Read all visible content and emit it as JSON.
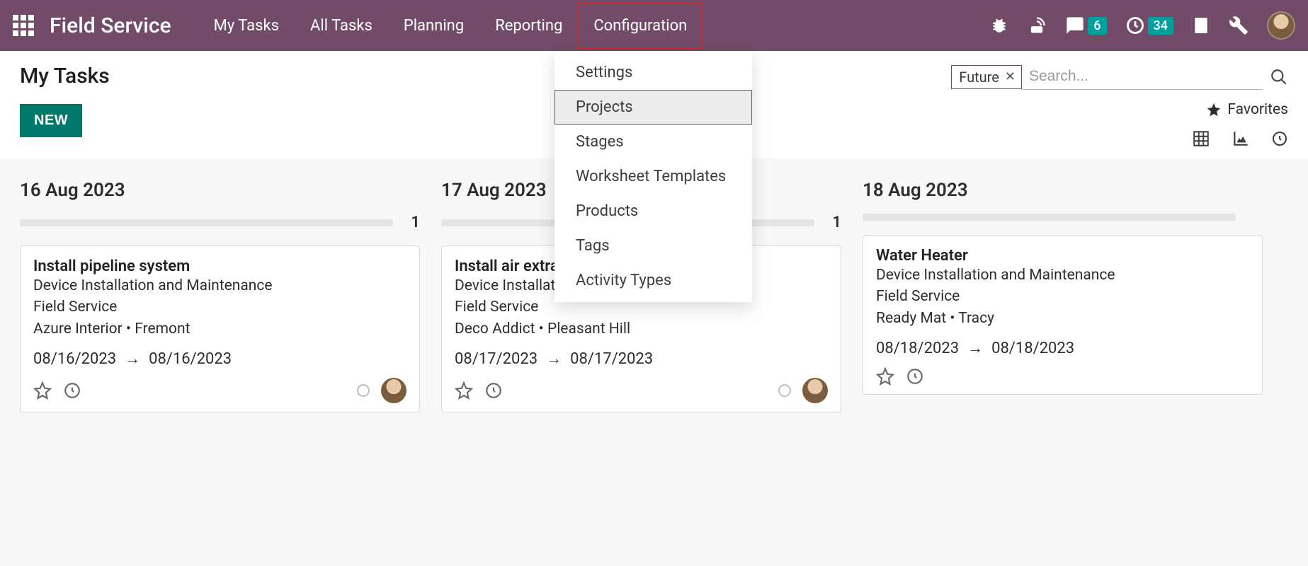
{
  "app_title": "Field Service",
  "nav": [
    {
      "label": "My Tasks"
    },
    {
      "label": "All Tasks"
    },
    {
      "label": "Planning"
    },
    {
      "label": "Reporting"
    },
    {
      "label": "Configuration",
      "active": true
    }
  ],
  "topbar_badges": {
    "messages": "6",
    "activities": "34"
  },
  "dropdown": {
    "items": [
      {
        "label": "Settings"
      },
      {
        "label": "Projects",
        "highlighted": true
      },
      {
        "label": "Stages"
      },
      {
        "label": "Worksheet Templates"
      },
      {
        "label": "Products"
      },
      {
        "label": "Tags"
      },
      {
        "label": "Activity Types"
      }
    ]
  },
  "page": {
    "title": "My Tasks",
    "new_button": "NEW"
  },
  "search": {
    "facet_label": "Future",
    "placeholder": "Search...",
    "favorites_label": "Favorites"
  },
  "columns": [
    {
      "date": "16 Aug 2023",
      "count": "1",
      "card": {
        "title": "Install pipeline system",
        "line1": "Device Installation and Maintenance",
        "line2": "Field Service",
        "line3": "Azure Interior • Fremont",
        "date_from": "08/16/2023",
        "date_to": "08/16/2023",
        "show_dot": true,
        "show_avatar": true
      }
    },
    {
      "date": "17 Aug 2023",
      "count": "1",
      "card": {
        "title": "Install air extractor",
        "line1": "Device Installation and Maintenance",
        "line2": "Field Service",
        "line3": "Deco Addict • Pleasant Hill",
        "date_from": "08/17/2023",
        "date_to": "08/17/2023",
        "show_dot": true,
        "show_avatar": true
      }
    },
    {
      "date": "18 Aug 2023",
      "count": "",
      "card": {
        "title": "Water Heater",
        "line1": "Device Installation and Maintenance",
        "line2": "Field Service",
        "line3": "Ready Mat • Tracy",
        "date_from": "08/18/2023",
        "date_to": "08/18/2023",
        "show_dot": false,
        "show_avatar": false
      }
    }
  ]
}
